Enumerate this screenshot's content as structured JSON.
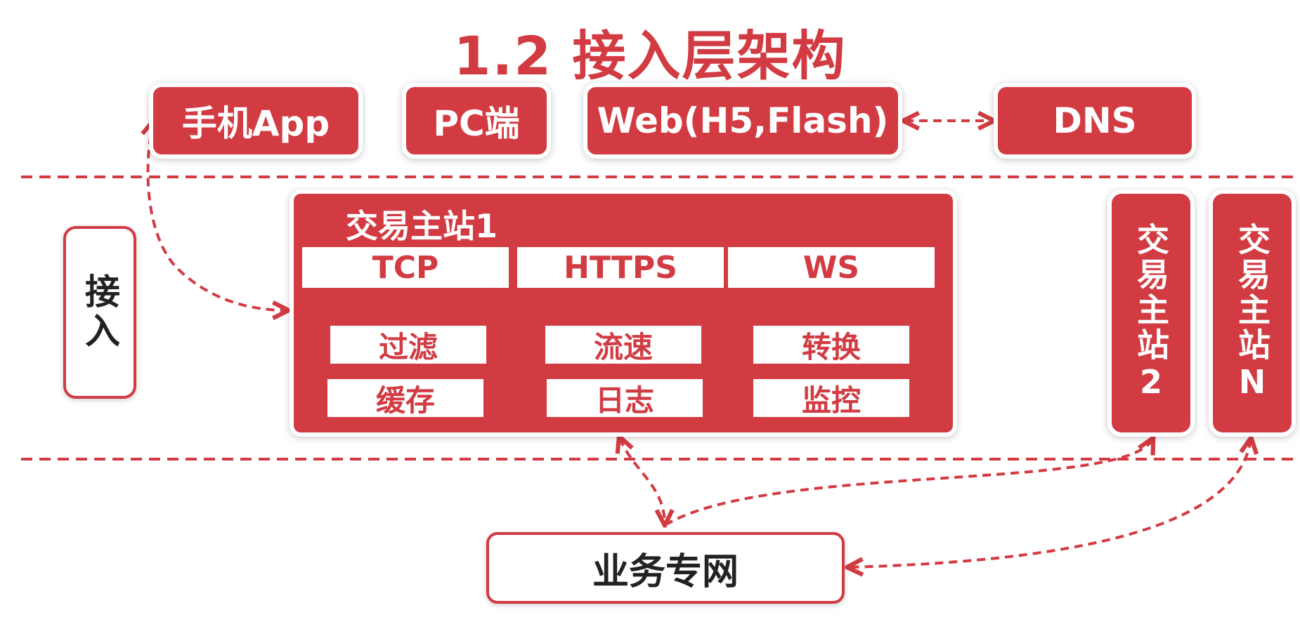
{
  "title": "1.2 接入层架构",
  "clients": {
    "mobile_app": "手机App",
    "pc": "PC端",
    "web": "Web(H5,Flash)",
    "dns": "DNS"
  },
  "layer_label": "接入",
  "station1": {
    "title": "交易主站1",
    "protocols": [
      "TCP",
      "HTTPS",
      "WS"
    ],
    "functions": [
      "过滤",
      "流速",
      "转换",
      "缓存",
      "日志",
      "监控"
    ]
  },
  "station2": "交易主站2",
  "stationN": "交易主站N",
  "business_network": "业务专网",
  "colors": {
    "accent": "#d23b42",
    "text_dark": "#222222",
    "background": "#ffffff"
  }
}
